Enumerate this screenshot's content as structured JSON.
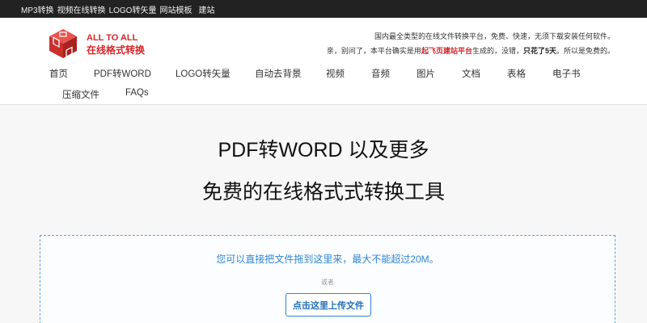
{
  "topbar": {
    "links": [
      "MP3转换",
      "视频在线转换",
      "LOGO转矢量",
      "网站模板",
      "建站"
    ]
  },
  "brand": {
    "name_en": "ALL TO ALL",
    "name_cn": "在线格式转换",
    "color": "#d9262a",
    "logo_icon": "red-cube-logo-icon"
  },
  "header": {
    "desc_line1": "国内最全类型的在线文件转换平台，免费、快速，无须下载安装任何软件。",
    "desc_line2_a": "亲，别问了，本平台确实是用",
    "desc_line2_highlight": "起飞页建站平台",
    "desc_line2_b": "生成的，没错，",
    "desc_line2_bold": "只花了5天",
    "desc_line2_c": "。所以是免费的。"
  },
  "nav": {
    "items": [
      "首页",
      "PDF转WORD",
      "LOGO转矢量",
      "自动去背景",
      "视频",
      "音频",
      "图片",
      "文档",
      "表格",
      "电子书",
      "压缩文件",
      "FAQs"
    ]
  },
  "hero": {
    "title": "PDF转WORD 以及更多",
    "subtitle": "免费的在线格式式转换工具"
  },
  "dropzone": {
    "hint": "您可以直接把文件拖到这里来，最大不能超过20M。",
    "or": "或者",
    "upload_label": "点击这里上传文件",
    "accent": "#2e86d6"
  }
}
